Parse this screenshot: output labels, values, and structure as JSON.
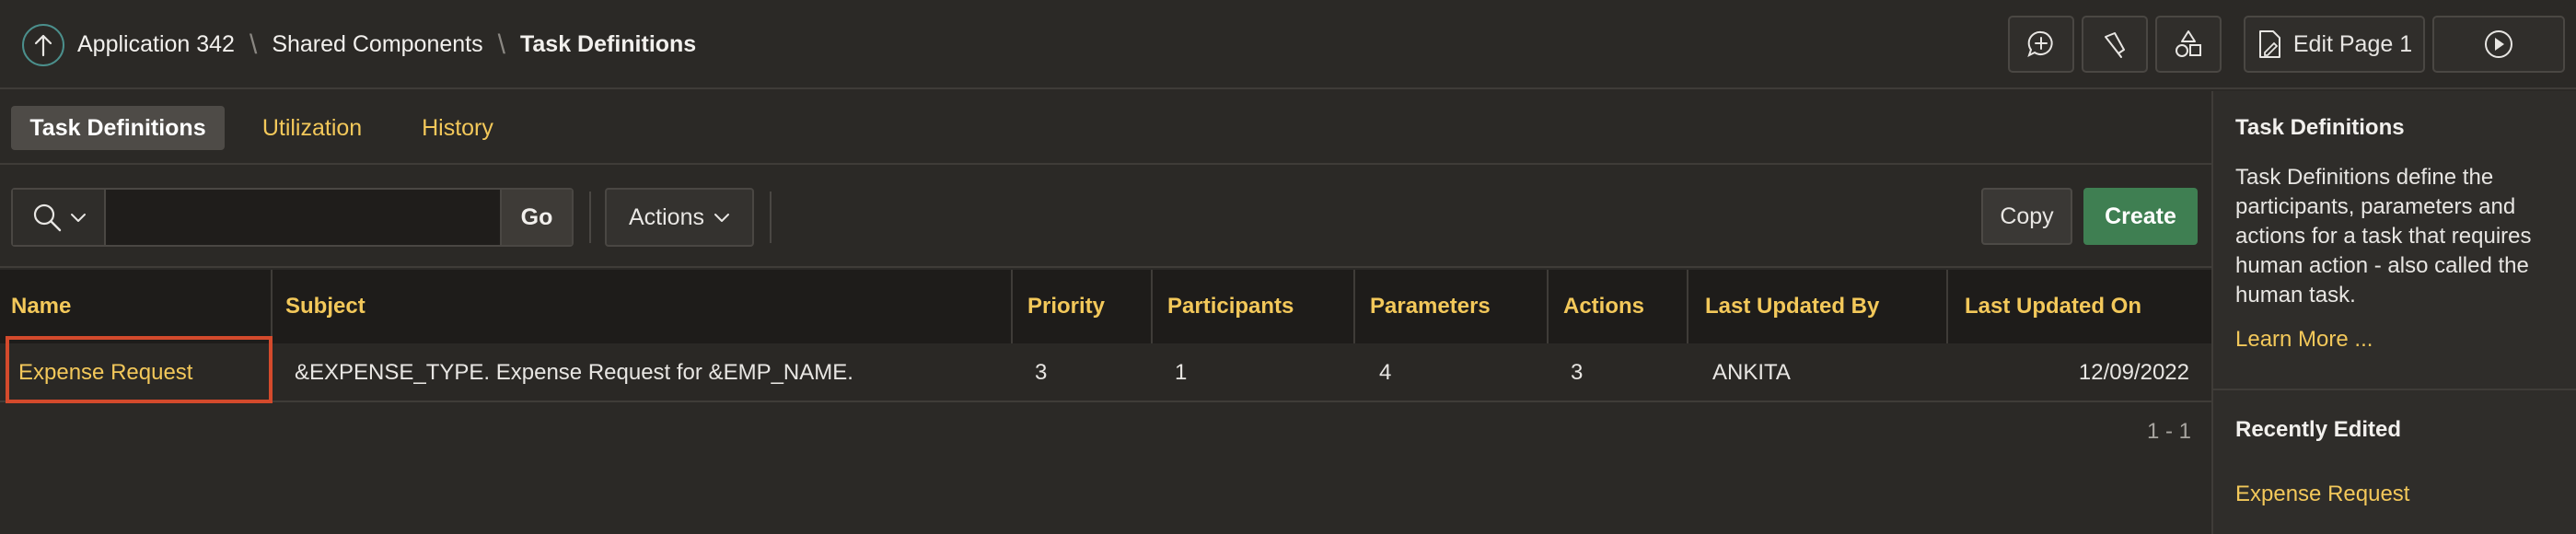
{
  "header": {
    "breadcrumb": {
      "app": "Application 342",
      "shared": "Shared Components",
      "current": "Task Definitions"
    },
    "edit_page_label": "Edit Page 1",
    "icons": [
      "add-comment-icon",
      "developer-tools-icon",
      "shapes-icon",
      "page-edit-icon",
      "run-icon"
    ]
  },
  "tabs": [
    {
      "label": "Task Definitions",
      "active": true
    },
    {
      "label": "Utilization",
      "active": false
    },
    {
      "label": "History",
      "active": false
    }
  ],
  "toolbar": {
    "search_value": "",
    "search_placeholder": "",
    "go_label": "Go",
    "actions_label": "Actions",
    "copy_label": "Copy",
    "create_label": "Create"
  },
  "table": {
    "columns": [
      "Name",
      "Subject",
      "Priority",
      "Participants",
      "Parameters",
      "Actions",
      "Last Updated By",
      "Last Updated On"
    ],
    "rows": [
      {
        "name": "Expense Request",
        "subject": "&EXPENSE_TYPE. Expense Request for &EMP_NAME.",
        "priority": "3",
        "participants": "1",
        "parameters": "4",
        "actions": "3",
        "updated_by": "ANKITA",
        "updated_on": "12/09/2022"
      }
    ],
    "pagination": "1 - 1"
  },
  "sidebar": {
    "title": "Task Definitions",
    "description": "Task Definitions define the participants, parameters and actions for a task that requires human action - also called the human task.",
    "learn_more": "Learn More ...",
    "recent_title": "Recently Edited",
    "recent_items": [
      "Expense Request"
    ]
  },
  "colors": {
    "accent_link": "#f3c85a",
    "create_button": "#3f7f52",
    "highlight": "#d44a2c",
    "up_icon": "#4b8f8c"
  }
}
